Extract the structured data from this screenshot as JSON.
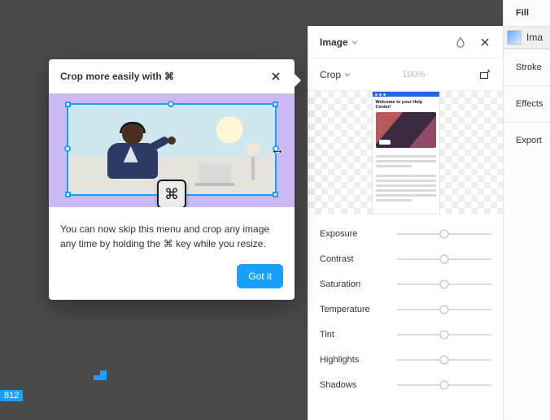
{
  "right_panel": {
    "fill_label": "Fill",
    "fill_type": "Ima",
    "stroke_label": "Stroke",
    "effects_label": "Effects",
    "export_label": "Export"
  },
  "image_panel": {
    "title": "Image",
    "crop_label": "Crop",
    "percent": "100%",
    "preview_title": "Welcome to your Help Center!",
    "sliders": [
      {
        "label": "Exposure",
        "pos": 50
      },
      {
        "label": "Contrast",
        "pos": 50
      },
      {
        "label": "Saturation",
        "pos": 50
      },
      {
        "label": "Temperature",
        "pos": 50
      },
      {
        "label": "Tint",
        "pos": 50
      },
      {
        "label": "Highlights",
        "pos": 50
      },
      {
        "label": "Shadows",
        "pos": 50
      }
    ]
  },
  "teach": {
    "title": "Crop more easily with ⌘",
    "body": "You can now skip this menu and crop any image any time by holding the ⌘ key while you resize.",
    "button": "Got it",
    "cmd_glyph": "⌘",
    "resize_glyph": "↔"
  },
  "canvas": {
    "badge": "812"
  }
}
